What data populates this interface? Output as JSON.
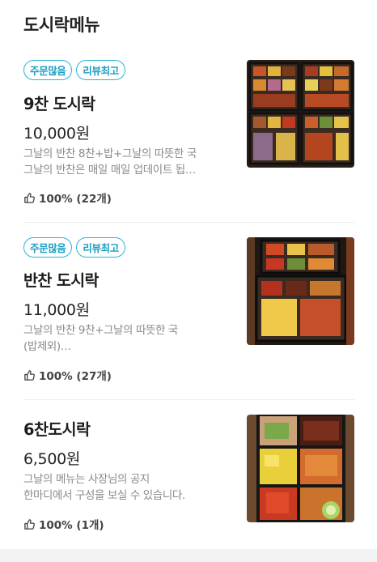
{
  "section": {
    "title": "도시락메뉴"
  },
  "menu": [
    {
      "badges": [
        "주문많음",
        "리뷰최고"
      ],
      "name": "9찬 도시락",
      "price": "10,000원",
      "desc": "그날의 반찬 8찬+밥+그날의 따뜻한 국\n그날의 반찬은 매일 매일 업데이트 됩…",
      "review": "100% (22개)",
      "photo_icon": "lunchbox-photo"
    },
    {
      "badges": [
        "주문많음",
        "리뷰최고"
      ],
      "name": "반찬 도시락",
      "price": "11,000원",
      "desc": "그날의 반찬 9찬+그날의 따뜻한 국\n(밥제외)…",
      "review": "100% (27개)",
      "photo_icon": "lunchbox-photo"
    },
    {
      "badges": [],
      "name": "6찬도시락",
      "price": "6,500원",
      "desc": "그날의 메뉴는 사장님의 공지\n한마디에서 구성을 보실 수 있습니다.",
      "review": "100% (1개)",
      "photo_icon": "lunchbox-photo"
    }
  ],
  "colors": {
    "badge": "#2bb5d6",
    "text": "#222222",
    "muted": "#8a8a8a"
  }
}
